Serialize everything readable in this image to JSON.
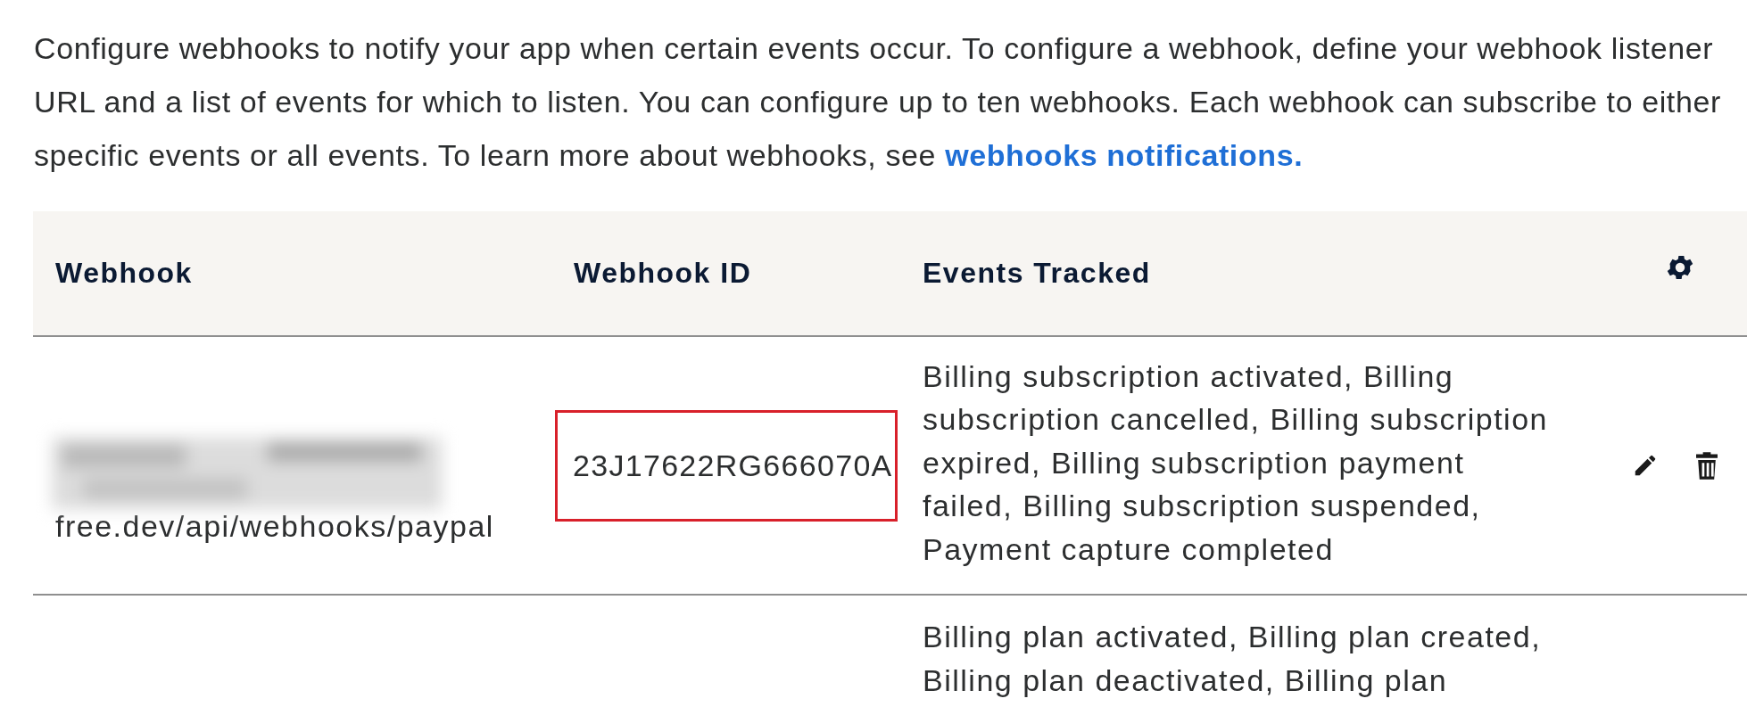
{
  "intro": {
    "text": "Configure webhooks to notify your app when certain events occur. To configure a webhook, define your webhook listener URL and a list of events for which to listen. You can configure up to ten webhooks. Each webhook can subscribe to either specific events or all events. To learn more about webhooks, see ",
    "link": "webhooks notifications."
  },
  "table": {
    "columns": [
      "Webhook",
      "Webhook ID",
      "Events Tracked"
    ],
    "rows": [
      {
        "webhook": "free.dev/api/webhooks/paypal",
        "webhook_blurred": true,
        "webhook_id": "23J17622RG666070A",
        "id_highlighted": true,
        "events": "Billing subscription activated, Billing subscription cancelled, Billing subscription expired, Billing subscription payment failed, Billing subscription suspended, Payment capture completed",
        "actions": true
      },
      {
        "events": "Billing plan activated, Billing plan created, Billing plan deactivated, Billing plan"
      }
    ]
  }
}
